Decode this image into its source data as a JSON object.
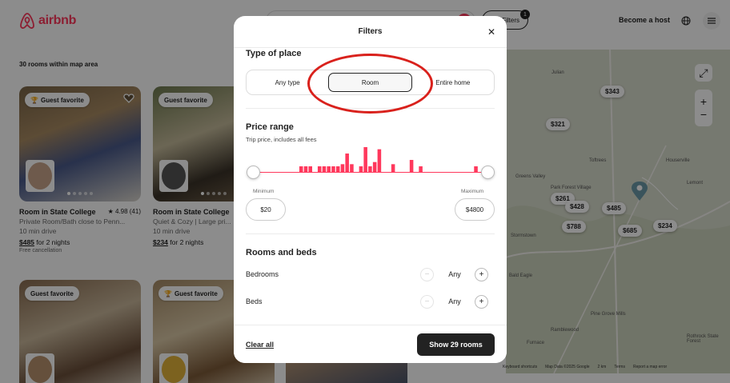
{
  "header": {
    "logo_text": "airbnb",
    "filters_label": "Filters",
    "filters_count": "1",
    "become_host": "Become a host"
  },
  "listings": {
    "count_label": "30 rooms within map area",
    "cards": [
      {
        "badge": "Guest favorite",
        "title": "Room in State College",
        "rating": "★ 4.98 (41)",
        "line1": "Private Room/Bath close to Penn...",
        "line2": "10 min drive",
        "price": "$485",
        "price_suffix": "for 2 nights",
        "note": "Free cancellation"
      },
      {
        "badge": "Guest favorite",
        "title": "Room in State College",
        "rating": "",
        "line1": "Quiet & Cozy | Large pri...",
        "line2": "10 min drive",
        "price": "$234",
        "price_suffix": "for 2 nights",
        "note": ""
      },
      {
        "badge": "Guest favorite"
      },
      {
        "badge": "Guest favorite"
      }
    ]
  },
  "map": {
    "pins": [
      "$343",
      "$321",
      "$261",
      "$428",
      "$485",
      "$788",
      "$685",
      "$234"
    ],
    "labels": [
      "Julian",
      "Houserville",
      "Lemont",
      "Toftrees",
      "Park Forest Village",
      "Ramblewood",
      "Pine Grove Mills",
      "Rothrock State Forest",
      "Greens Valley",
      "Bald Eagle",
      "Stormstown",
      "Furnace"
    ],
    "footer": [
      "Keyboard shortcuts",
      "Map Data ©2025 Google",
      "2 km",
      "Terms",
      "Report a map error"
    ]
  },
  "modal": {
    "title": "Filters",
    "type_heading": "Type of place",
    "type_options": [
      "Any type",
      "Room",
      "Entire home"
    ],
    "type_selected": "Room",
    "price_heading": "Price range",
    "price_sub": "Trip price, includes all fees",
    "histogram": [
      0,
      0,
      0,
      0,
      0,
      0,
      0,
      0,
      0,
      0,
      3,
      3,
      3,
      0,
      3,
      3,
      3,
      3,
      3,
      4,
      9,
      4,
      0,
      3,
      12,
      3,
      5,
      11,
      0,
      0,
      4,
      0,
      0,
      0,
      6,
      0,
      3,
      0,
      0,
      0,
      0,
      0,
      0,
      0,
      0,
      0,
      0,
      0,
      3,
      0,
      0
    ],
    "min_label": "Minimum",
    "max_label": "Maximum",
    "min_value": "$20",
    "max_value": "$4800",
    "min_fraction": 0.0,
    "max_fraction": 1.0,
    "rooms_heading": "Rooms and beds",
    "bedrooms_label": "Bedrooms",
    "bedrooms_value": "Any",
    "beds_label": "Beds",
    "beds_value": "Any",
    "clear_all": "Clear all",
    "show_button": "Show 29 rooms",
    "accent": "#ff385c"
  }
}
